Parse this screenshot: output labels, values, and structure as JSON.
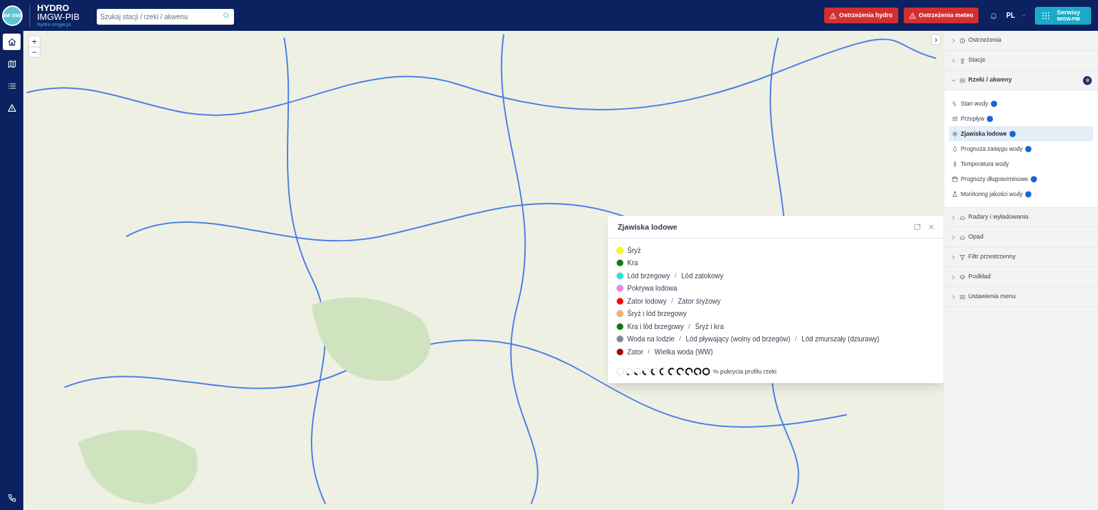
{
  "header": {
    "logo_text": "IM GW",
    "brand_title": "HYDRO",
    "brand_subtitle": "IMGW-PIB",
    "brand_url": "hydro.imgw.pl",
    "search": {
      "placeholder": "Szukaj stacji / rzeki / akwenu"
    },
    "warning_buttons": [
      {
        "label": "Ostrzeżenia hydro"
      },
      {
        "label": "Ostrzeżenia meteo"
      }
    ],
    "language": "PL",
    "services_button": {
      "line1": "Serwisy",
      "line2": "IMGW-PIB"
    }
  },
  "nav": [
    {
      "selected": true
    },
    {
      "selected": false
    },
    {
      "selected": false
    },
    {
      "selected": false
    }
  ],
  "map": {
    "zoom_in": "+",
    "zoom_out": "−",
    "panel_toggle": "›"
  },
  "panel": [
    {
      "label": "Ostrzeżenia",
      "expanded": false
    },
    {
      "label": "Stacje",
      "expanded": false
    },
    {
      "label": "Rzeki / akweny",
      "expanded": true,
      "children": [
        {
          "label": "Stan wody",
          "info": true,
          "selected": false
        },
        {
          "label": "Przepływ",
          "info": true,
          "selected": false
        },
        {
          "label": "Zjawiska lodowe",
          "info": true,
          "selected": true
        },
        {
          "label": "Prognoza zasięgu wody",
          "info": true,
          "selected": false
        },
        {
          "label": "Temperatura wody",
          "info": false,
          "selected": false
        },
        {
          "label": "Prognozy długoterminowe",
          "info": true,
          "selected": false
        },
        {
          "label": "Monitoring jakości wody",
          "info": true,
          "selected": false
        }
      ]
    },
    {
      "label": "Radary i wyładowania",
      "expanded": false
    },
    {
      "label": "Opad",
      "expanded": false
    },
    {
      "label": "Filtr przestrzenny",
      "expanded": false
    },
    {
      "label": "Podkład",
      "expanded": false
    },
    {
      "label": "Ustawienia menu",
      "expanded": false
    }
  ],
  "legend": {
    "title": "Zjawiska lodowe",
    "items": [
      {
        "color": "#ffff00",
        "labels": [
          "Śryż"
        ]
      },
      {
        "color": "#0a7a0a",
        "labels": [
          "Kra"
        ]
      },
      {
        "color": "#22e5e5",
        "labels": [
          "Lód brzegowy",
          "Lód zatokowy"
        ]
      },
      {
        "color": "#f07ff0",
        "labels": [
          "Pokrywa lodowa"
        ]
      },
      {
        "color": "#ff0000",
        "labels": [
          "Zator lodowy",
          "Zator śryżowy"
        ]
      },
      {
        "color": "#f5b060",
        "labels": [
          "Śryż i lód brzegowy"
        ]
      },
      {
        "color": "#0a7a0a",
        "labels": [
          "Kra i lód brzegowy",
          "Śryż i kra"
        ]
      },
      {
        "color": "#888888",
        "labels": [
          "Woda na lodzie",
          "Lód pływający (wolny od brzegów)",
          "Lód zmurszały (dziurawy)"
        ]
      },
      {
        "color": "#b00000",
        "labels": [
          "Zator",
          "Wielka woda (WW)"
        ]
      }
    ],
    "separator": "/",
    "coverage_label": "% pokrycia profilu rzeki"
  }
}
